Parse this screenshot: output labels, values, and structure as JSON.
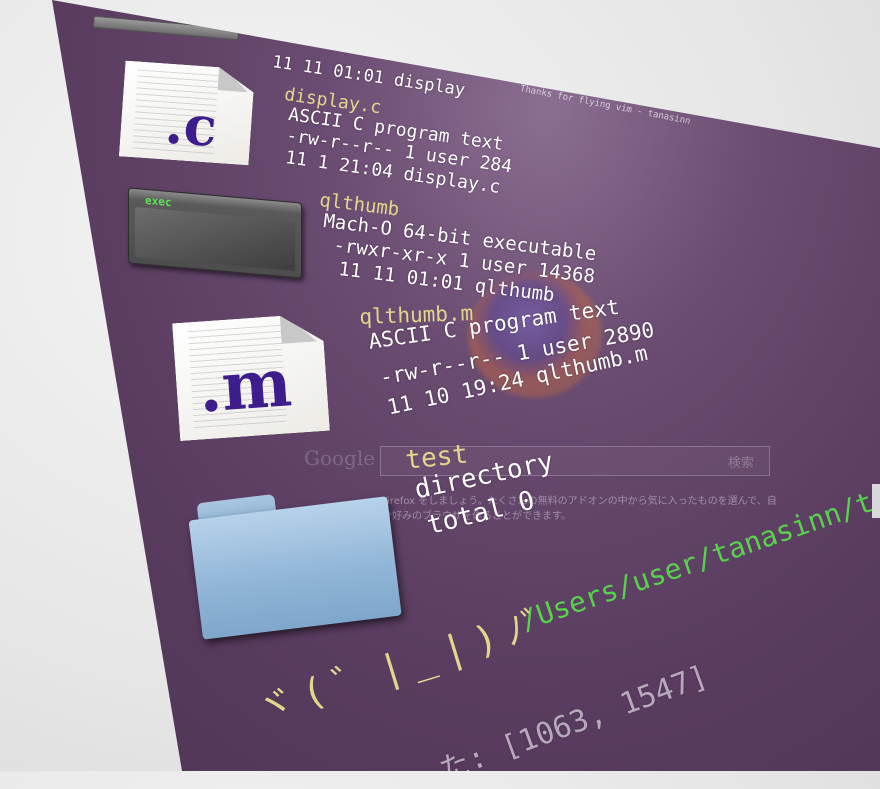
{
  "terminal": {
    "header_line": "11 11 01:01 display",
    "window_title": "Thanks for flying vim - tanasinn",
    "files": [
      {
        "icon": "c-source-file-icon",
        "icon_ext": ".c",
        "name": "display.c",
        "type": "ASCII C program text",
        "perms": "-rw-r--r-- 1 user 284",
        "date": "11 1 21:04 display.c"
      },
      {
        "icon": "exec-icon",
        "icon_ext": "exec",
        "name": "qlthumb",
        "type": "Mach-O 64-bit executable",
        "perms": "-rwxr-xr-x 1 user 14368",
        "date": "11 11 01:01 qlthumb"
      },
      {
        "icon": "m-source-file-icon",
        "icon_ext": ".m",
        "name": "qlthumb.m",
        "type": "ASCII C program text",
        "perms": "-rw-r--r-- 1 user 2890",
        "date": "11 10 19:24 qlthumb.m"
      },
      {
        "icon": "folder-icon",
        "name": "test",
        "type": "directory",
        "perms": "total 0"
      }
    ],
    "prompt_face": "ヾ(゛|_|)ﾉﾞ",
    "prompt_path": "/Users/user/tanasinn/tools/thumb",
    "bottom_line": "た: [1063, 1547]"
  },
  "background_overlay": {
    "search_logo": "Google",
    "search_button": "検索",
    "text": "Firefox をしましょう。たくさんの無料のアドオンの中から気に入ったものを選んで、自分好みのブラウザを作ることができます。"
  }
}
